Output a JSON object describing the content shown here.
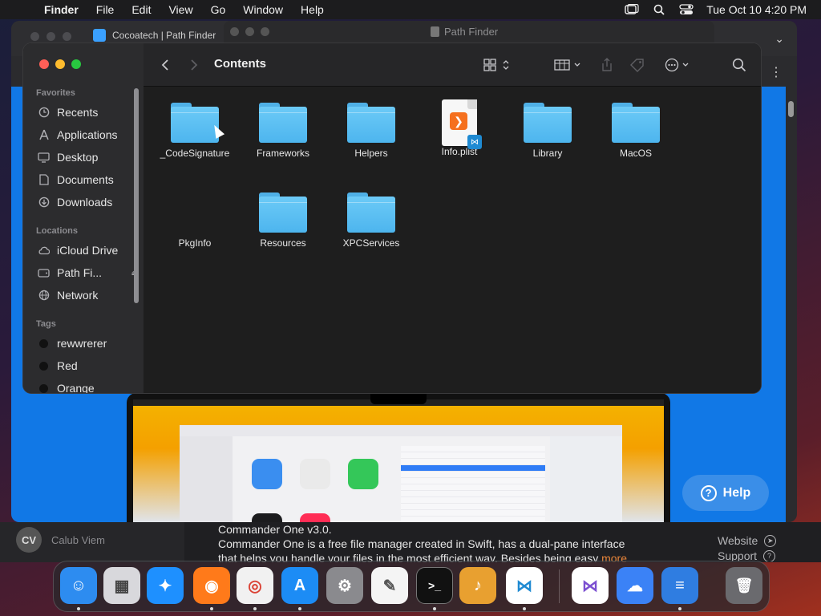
{
  "menubar": {
    "app": "Finder",
    "items": [
      "File",
      "Edit",
      "View",
      "Go",
      "Window",
      "Help"
    ],
    "clock": "Tue Oct 10  4:20 PM",
    "status_icons": [
      "window-icon",
      "search-icon",
      "control-center-icon"
    ]
  },
  "browser": {
    "tab_title": "Cocoatech | Path Finder"
  },
  "pathfinder": {
    "title": "Path Finder"
  },
  "finder": {
    "title": "Contents",
    "sidebar": {
      "favorites_label": "Favorites",
      "favorites": [
        {
          "label": "Recents",
          "icon": "clock-icon"
        },
        {
          "label": "Applications",
          "icon": "applications-icon"
        },
        {
          "label": "Desktop",
          "icon": "desktop-icon"
        },
        {
          "label": "Documents",
          "icon": "document-icon"
        },
        {
          "label": "Downloads",
          "icon": "download-icon"
        }
      ],
      "locations_label": "Locations",
      "locations": [
        {
          "label": "iCloud Drive",
          "icon": "cloud-icon"
        },
        {
          "label": "Path Fi...",
          "icon": "drive-icon"
        },
        {
          "label": "Network",
          "icon": "network-icon"
        }
      ],
      "tags_label": "Tags",
      "tags": [
        {
          "label": "rewwrerer",
          "color": "#1a1a1a"
        },
        {
          "label": "Red",
          "color": "#111111"
        },
        {
          "label": "Orange",
          "color": "#111111"
        }
      ]
    },
    "items": [
      {
        "name": "_CodeSignature",
        "kind": "folder"
      },
      {
        "name": "Frameworks",
        "kind": "folder"
      },
      {
        "name": "Helpers",
        "kind": "folder"
      },
      {
        "name": "Info.plist",
        "kind": "plist"
      },
      {
        "name": "Library",
        "kind": "folder"
      },
      {
        "name": "MacOS",
        "kind": "folder"
      },
      {
        "name": "PkgInfo",
        "kind": "blank"
      },
      {
        "name": "Resources",
        "kind": "folder"
      },
      {
        "name": "XPCServices",
        "kind": "folder"
      }
    ]
  },
  "page": {
    "author": "Calub Viem",
    "author_initials": "CV",
    "desc_title": "Commander One v3.0.",
    "desc_body": "Commander One is a free file manager created in Swift, has a dual-pane interface",
    "desc_body2": "that helps you handle your files in the most efficient way. Besides being easy",
    "more": "more",
    "links": [
      "Website",
      "Support"
    ],
    "help_label": "Help"
  },
  "dock": {
    "apps": [
      {
        "name": "Finder",
        "color": "#2d8cf0",
        "glyph": "☺"
      },
      {
        "name": "Launchpad",
        "color": "#d8d8dc",
        "glyph": "▦"
      },
      {
        "name": "Safari",
        "color": "#1e90ff",
        "glyph": "✦"
      },
      {
        "name": "Firefox",
        "color": "#ff7a1a",
        "glyph": "◉"
      },
      {
        "name": "Chrome",
        "color": "#f1f1f1",
        "glyph": "◎"
      },
      {
        "name": "App Store",
        "color": "#1c8cf5",
        "glyph": "A"
      },
      {
        "name": "System Settings",
        "color": "#8a8a8e",
        "glyph": "⚙"
      },
      {
        "name": "TextEdit",
        "color": "#f4f4f4",
        "glyph": "✎"
      },
      {
        "name": "Terminal",
        "color": "#111111",
        "glyph": ">_"
      },
      {
        "name": "GarageBand",
        "color": "#e8a030",
        "glyph": "♪"
      },
      {
        "name": "VS Code",
        "color": "#ffffff",
        "glyph": "⋈"
      },
      {
        "name": "Visual Studio",
        "color": "#7b4fd1",
        "glyph": "⋈"
      },
      {
        "name": "Weather",
        "color": "#3b82f6",
        "glyph": "☁"
      },
      {
        "name": "Commander One",
        "color": "#2f7de1",
        "glyph": "≡"
      },
      {
        "name": "Trash",
        "color": "#6a6a6e",
        "glyph": "🗑"
      }
    ]
  }
}
